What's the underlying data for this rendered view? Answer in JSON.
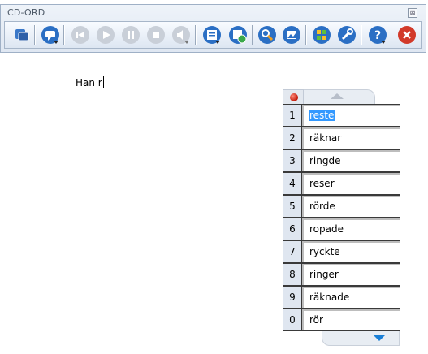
{
  "window": {
    "title": "CD-ORD",
    "close_label": "⊠"
  },
  "toolbar": {
    "buttons": [
      {
        "name": "settings-toggle-icon"
      },
      {
        "name": "speech-menu-icon"
      },
      {
        "name": "rewind-icon"
      },
      {
        "name": "play-icon"
      },
      {
        "name": "pause-icon"
      },
      {
        "name": "stop-icon"
      },
      {
        "name": "volume-icon"
      },
      {
        "name": "document-menu-icon"
      },
      {
        "name": "web-icon"
      },
      {
        "name": "search-dictionary-icon"
      },
      {
        "name": "image-icon"
      },
      {
        "name": "wordlist-icon"
      },
      {
        "name": "tools-icon"
      },
      {
        "name": "help-icon"
      },
      {
        "name": "exit-icon"
      }
    ]
  },
  "document": {
    "text": "Han r"
  },
  "prediction": {
    "items": [
      {
        "num": "1",
        "word": "reste",
        "selected": true
      },
      {
        "num": "2",
        "word": "räknar"
      },
      {
        "num": "3",
        "word": "ringde"
      },
      {
        "num": "4",
        "word": "reser"
      },
      {
        "num": "5",
        "word": "rörde"
      },
      {
        "num": "6",
        "word": "ropade"
      },
      {
        "num": "7",
        "word": "ryckte"
      },
      {
        "num": "8",
        "word": "ringer"
      },
      {
        "num": "9",
        "word": "räknade"
      },
      {
        "num": "0",
        "word": "rör"
      }
    ]
  },
  "colors": {
    "selection": "#3399ff",
    "record": "#d0200c",
    "scroll_down": "#1a7fd6"
  }
}
